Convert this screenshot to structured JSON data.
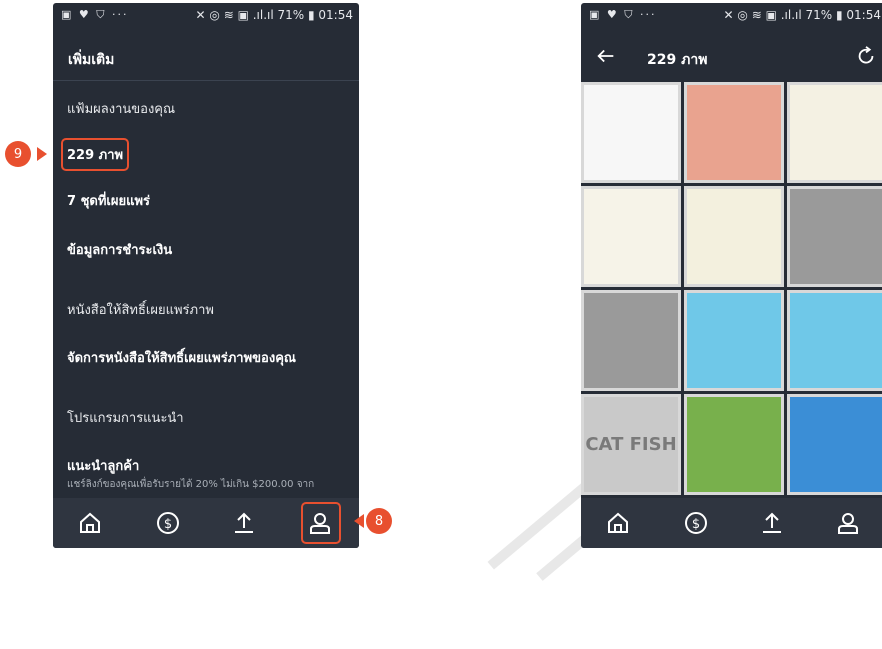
{
  "left": {
    "status": {
      "left": "▣ ♥ ⛉ ···",
      "right": "✕ ◎ ≋ ▣ .ıl.ıl 71% ▮ 01:54"
    },
    "header_title": "เพิ่มเติม",
    "items": [
      {
        "label": "แฟ้มผลงานของคุณ"
      },
      {
        "label": "229 ภาพ"
      },
      {
        "label": "7 ชุดที่เผยแพร่"
      },
      {
        "label": "ข้อมูลการชำระเงิน"
      },
      {
        "label": "หนังสือให้สิทธิ์เผยแพร่ภาพ"
      },
      {
        "label": "จัดการหนังสือให้สิทธิ์เผยแพร่ภาพของคุณ"
      },
      {
        "label": "โปรแกรมการแนะนำ"
      },
      {
        "label": "แนะนำลูกค้า"
      },
      {
        "label": "แชร์ลิงก์ของคุณเพื่อรับรายได้ 20% ไม่เกิน $200.00 จาก"
      }
    ],
    "nav": [
      {
        "icon": "home-icon"
      },
      {
        "icon": "earnings-icon",
        "glyph": "$"
      },
      {
        "icon": "upload-icon"
      },
      {
        "icon": "profile-icon"
      }
    ]
  },
  "right": {
    "status": {
      "left": "▣ ♥ ⛉ ···",
      "right": "✕ ◎ ≋ ▣ .ıl.ıl 71% ▮ 01:54"
    },
    "header_title": "229 ภาพ",
    "thumbs": [
      {
        "bg": "#f7f7f7",
        "label": ""
      },
      {
        "bg": "#e9a38f",
        "label": ""
      },
      {
        "bg": "#f4f1e3",
        "label": ""
      },
      {
        "bg": "#f6f3e8",
        "label": ""
      },
      {
        "bg": "#f3f0de",
        "label": ""
      },
      {
        "bg": "#9a9a9a",
        "label": ""
      },
      {
        "bg": "#9a9a9a",
        "label": ""
      },
      {
        "bg": "#6fc8e8",
        "label": ""
      },
      {
        "bg": "#6fc8e8",
        "label": ""
      },
      {
        "bg": "#c9c9c9",
        "label": "CAT FISH"
      },
      {
        "bg": "#78b04c",
        "label": ""
      },
      {
        "bg": "#3b8ed6",
        "label": ""
      }
    ],
    "nav": [
      {
        "icon": "home-icon"
      },
      {
        "icon": "earnings-icon",
        "glyph": "$"
      },
      {
        "icon": "upload-icon"
      },
      {
        "icon": "profile-icon"
      }
    ]
  },
  "callouts": {
    "nine": "9",
    "eight": "8"
  },
  "colors": {
    "accent": "#e8502f",
    "panel": "#262c36",
    "navbar": "#2f3540"
  }
}
